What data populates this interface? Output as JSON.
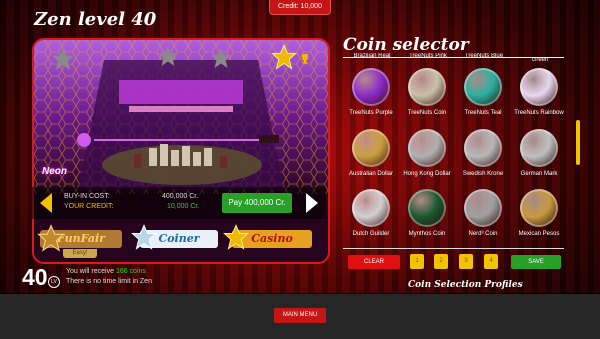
{
  "header": {
    "credit": "Credit: 10,000",
    "title": "Zen level 40"
  },
  "machine": {
    "name": "Neon",
    "buy_in_label": "BUY-IN COST:",
    "buy_in_value": "400,000 Cr.",
    "your_credit_label": "YOUR CREDIT:",
    "your_credit_value": "10,000 Cr.",
    "pay_label": "Pay 400,000 Cr.",
    "stars_earned": 1,
    "stars_total": 4
  },
  "modes": [
    {
      "label": "FunFair",
      "tag": "Easy!"
    },
    {
      "label": "Coiner"
    },
    {
      "label": "Casino"
    }
  ],
  "level": {
    "number": "40",
    "lvl_label": "LV",
    "line1_prefix": "You will receive ",
    "line1_coins": "166 coins",
    "line2": "There is no time limit in Zen"
  },
  "coin_selector": {
    "title": "Coin selector",
    "top_cut_labels": [
      "Brazilian Real",
      "TreeNuts Pink",
      "TreeNuts Blue",
      "Green"
    ],
    "coins": [
      {
        "label": "TreeNuts Purple",
        "color": "#8a2bc8"
      },
      {
        "label": "TreeNuts Coin",
        "color": "#c8c0a8"
      },
      {
        "label": "TreeNuts Teal",
        "color": "#2ab0a0"
      },
      {
        "label": "TreeNuts Rainbow",
        "color": "#e8d8f0"
      },
      {
        "label": "Australian Dollar",
        "color": "#c8a040"
      },
      {
        "label": "Hong Kong Dollar",
        "color": "#b0b0b0"
      },
      {
        "label": "Swedish Krone",
        "color": "#b8b8b8"
      },
      {
        "label": "German Mark",
        "color": "#c0c0c0"
      },
      {
        "label": "Dutch Guilder",
        "color": "#d0d0d0"
      },
      {
        "label": "Mynthos Coin",
        "color": "#1a5a30"
      },
      {
        "label": "Nerd³ Coin",
        "color": "#a0a0a0"
      },
      {
        "label": "Mexican Pesos",
        "color": "#c89a40"
      }
    ],
    "clear_label": "CLEAR",
    "slot_labels": [
      "1",
      "2",
      "3",
      "4"
    ],
    "save_label": "SAVE",
    "profiles_label": "Coin Selection Profiles"
  },
  "footer": {
    "main_menu": "MAIN MENU"
  },
  "colors": {
    "accent_red": "#c51515",
    "accent_green": "#28a028",
    "accent_yellow": "#f2c400"
  }
}
